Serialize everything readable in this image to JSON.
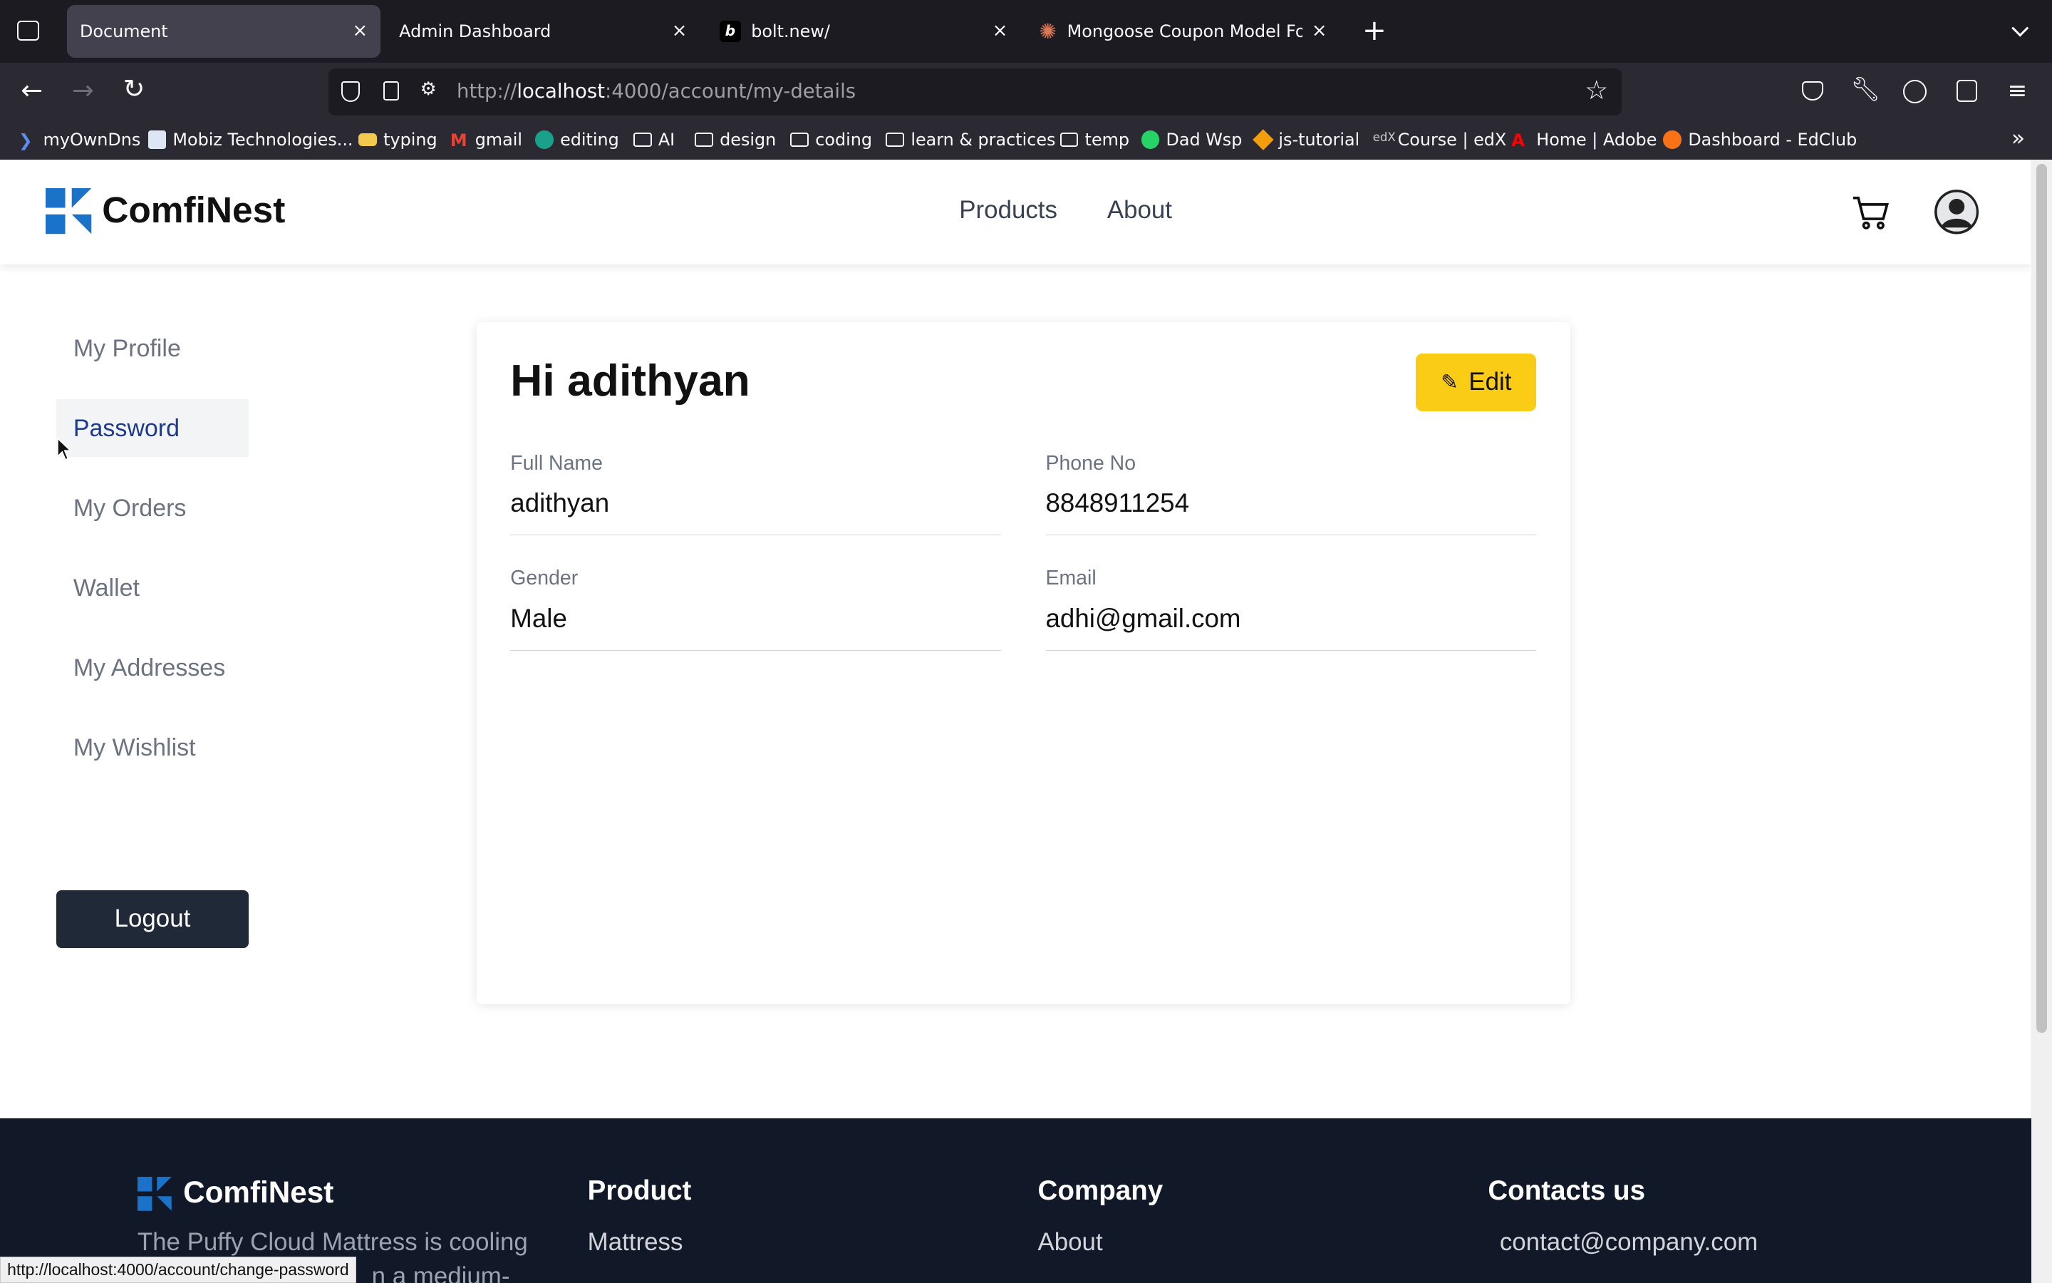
{
  "browser": {
    "tabs": [
      {
        "title": "Document",
        "active": true,
        "close": "×"
      },
      {
        "title": "Admin Dashboard",
        "active": false,
        "close": "×"
      },
      {
        "title": "bolt.new/",
        "active": false,
        "close": "×"
      },
      {
        "title": "Mongoose Coupon Model Form",
        "active": false,
        "close": "×"
      }
    ],
    "new_tab": "+",
    "url_host_prefix": "http://",
    "url_host": "localhost",
    "url_path": ":4000/account/my-details",
    "bookmarks": [
      "myOwnDns",
      "Mobiz Technologies...",
      "typing",
      "gmail",
      "editing",
      "AI",
      "design",
      "coding",
      "learn & practices",
      "temp",
      "Dad Wsp",
      "js-tutorial",
      "Course | edX",
      "Home | Adobe",
      "Dashboard - EdClub"
    ],
    "status_url": "http://localhost:4000/account/change-password"
  },
  "site": {
    "brand": "ComfiNest",
    "nav": [
      "Products",
      "About"
    ],
    "accent": "#1a73c8"
  },
  "sidebar": {
    "items": [
      {
        "label": "My Profile"
      },
      {
        "label": "Password",
        "active": true
      },
      {
        "label": "My Orders"
      },
      {
        "label": "Wallet"
      },
      {
        "label": "My Addresses"
      },
      {
        "label": "My Wishlist"
      }
    ],
    "logout": "Logout"
  },
  "profile": {
    "greeting": "Hi adithyan",
    "edit_label": "Edit",
    "edit_color": "#facc15",
    "fields": {
      "full_name": {
        "label": "Full Name",
        "value": "adithyan"
      },
      "phone": {
        "label": "Phone No",
        "value": "8848911254"
      },
      "gender": {
        "label": "Gender",
        "value": "Male"
      },
      "email": {
        "label": "Email",
        "value": "adhi@gmail.com"
      }
    }
  },
  "footer": {
    "brand": "ComfiNest",
    "tagline_line1": "The Puffy Cloud Mattress is cooling",
    "tagline_line2": "n a medium-",
    "product_heading": "Product",
    "product_link": "Mattress",
    "company_heading": "Company",
    "company_link": "About",
    "contact_heading": "Contacts us",
    "contact_email": "contact@company.com"
  }
}
